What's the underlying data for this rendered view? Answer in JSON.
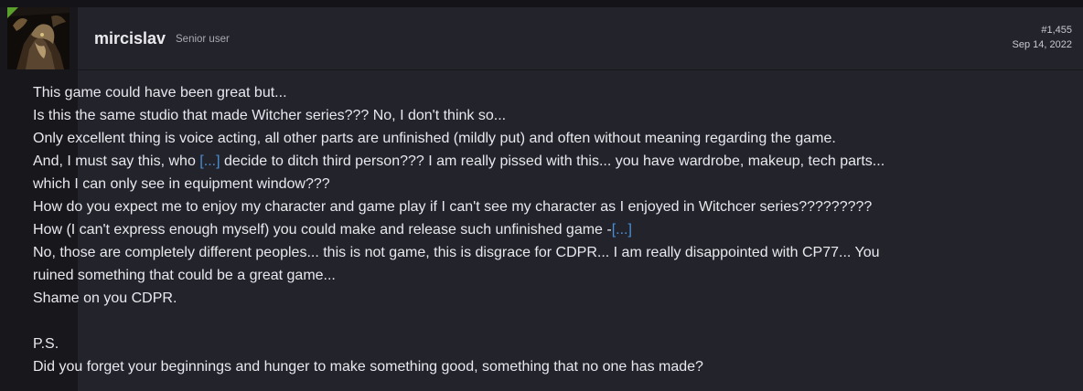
{
  "post": {
    "username": "mircislav",
    "user_title": "Senior user",
    "post_number": "#1,455",
    "date": "Sep 14, 2022",
    "lines": {
      "l1": "This game could have been great but...",
      "l2": "Is this the same studio that made Witcher series??? No, I don't think so...",
      "l3": "Only excellent thing is voice acting, all other parts are unfinished (mildly put) and often without meaning regarding the game.",
      "l4a": "And, I must say this, who ",
      "l4link": "[...]",
      "l4b": " decide to ditch third person??? I am really pissed with this... you have wardrobe, makeup, tech parts...",
      "l5": "which I can only see in equipment window???",
      "l6": "How do you expect me to enjoy my character and game play if I can't see my character as I enjoyed in Witchcer series?????????",
      "l7a": "How (I can't express enough myself) you could make and release such unfinished game -",
      "l7link": "[...]",
      "l8": "No, those are completely different peoples... this is not game, this is disgrace for CDPR... I am really disappointed with CP77... You",
      "l9": "ruined something that could be a great game...",
      "l10": "Shame on you CDPR.",
      "l11": "P.S.",
      "l12": "Did you forget your beginnings and hunger to make something good, something that no one has made?"
    }
  },
  "colors": {
    "background": "#17171c",
    "post_background": "#23232b",
    "text": "#e8e8ee",
    "link": "#4a8fd4",
    "avatar_badge": "#5aa02c"
  },
  "icons": {
    "avatar": "witcher-avatar"
  }
}
